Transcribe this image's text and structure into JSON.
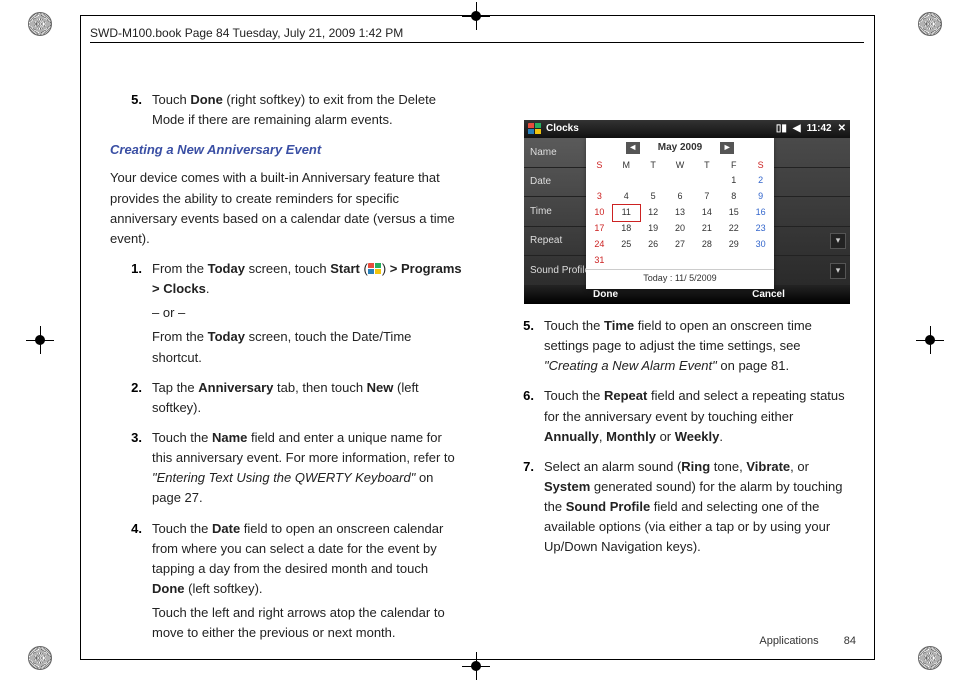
{
  "header": "SWD-M100.book  Page 84  Tuesday, July 21, 2009  1:42 PM",
  "left": {
    "pre_step": {
      "num": "5.",
      "text_a": "Touch ",
      "text_b": "Done",
      "text_c": " (right softkey) to exit from the Delete Mode if there are remaining alarm events."
    },
    "heading": "Creating a New Anniversary Event",
    "intro": "Your device comes with a built-in Anniversary feature that provides the ability to create reminders for specific anniversary events based on a calendar date (versus a time event).",
    "s1": {
      "num": "1.",
      "a": "From the ",
      "b": "Today",
      "c": " screen, touch ",
      "d": "Start",
      "e": " (",
      "f": ") ",
      "g": "> Programs > Clocks",
      "h": ".",
      "or": "– or –",
      "alt_a": "From the ",
      "alt_b": "Today",
      "alt_c": " screen, touch the Date/Time shortcut."
    },
    "s2": {
      "num": "2.",
      "a": "Tap the ",
      "b": "Anniversary",
      "c": " tab, then touch ",
      "d": "New",
      "e": " (left softkey)."
    },
    "s3": {
      "num": "3.",
      "a": "Touch the ",
      "b": "Name",
      "c": " field and enter a unique name for this anniversary event. For more information, refer to ",
      "d": "\"Entering Text Using the QWERTY Keyboard\"",
      "e": "  on page 27."
    },
    "s4": {
      "num": "4.",
      "a": "Touch the ",
      "b": "Date",
      "c": " field to open an onscreen calendar from where you can select a date for the event by tapping a day from the desired month and touch ",
      "d": "Done",
      "e": " (left softkey).",
      "f": "Touch the left and right arrows atop the calendar to move to either the previous or next month."
    }
  },
  "right": {
    "s5": {
      "num": "5.",
      "a": "Touch the ",
      "b": "Time",
      "c": " field to open an onscreen time settings page to adjust the time settings, see ",
      "d": "\"Creating a New Alarm Event\"",
      "e": " on page 81."
    },
    "s6": {
      "num": "6.",
      "a": "Touch the ",
      "b": "Repeat",
      "c": " field and select a repeating status for the anniversary event by touching either ",
      "d": "Annually",
      "e": ", ",
      "f": "Monthly",
      "g": " or ",
      "h": "Weekly",
      "i": "."
    },
    "s7": {
      "num": "7.",
      "a": "Select an alarm sound (",
      "b": "Ring",
      "c": " tone, ",
      "d": "Vibrate",
      "e": ", or ",
      "f": "System",
      "g": " generated sound) for the alarm by touching the ",
      "h": "Sound Profile",
      "i": " field and selecting one of the available options (via either a tap or by using your Up/Down Navigation keys)."
    }
  },
  "shot": {
    "title": "Clocks",
    "time": "11:42",
    "labels": [
      "Name",
      "Date",
      "Time",
      "Repeat",
      "Sound Profile"
    ],
    "cal_month": "May  2009",
    "cal_today": "Today : 11/ 5/2009",
    "dow": [
      "S",
      "M",
      "T",
      "W",
      "T",
      "F",
      "S"
    ],
    "days": [
      [
        "",
        "",
        "",
        "",
        "",
        "1",
        "2"
      ],
      [
        "3",
        "4",
        "5",
        "6",
        "7",
        "8",
        "9"
      ],
      [
        "10",
        "11",
        "12",
        "13",
        "14",
        "15",
        "16"
      ],
      [
        "17",
        "18",
        "19",
        "20",
        "21",
        "22",
        "23"
      ],
      [
        "24",
        "25",
        "26",
        "27",
        "28",
        "29",
        "30"
      ],
      [
        "31",
        "",
        "",
        "",
        "",
        "",
        ""
      ]
    ],
    "sk_left": "Done",
    "sk_right": "Cancel"
  },
  "footer": {
    "section": "Applications",
    "page": "84"
  }
}
